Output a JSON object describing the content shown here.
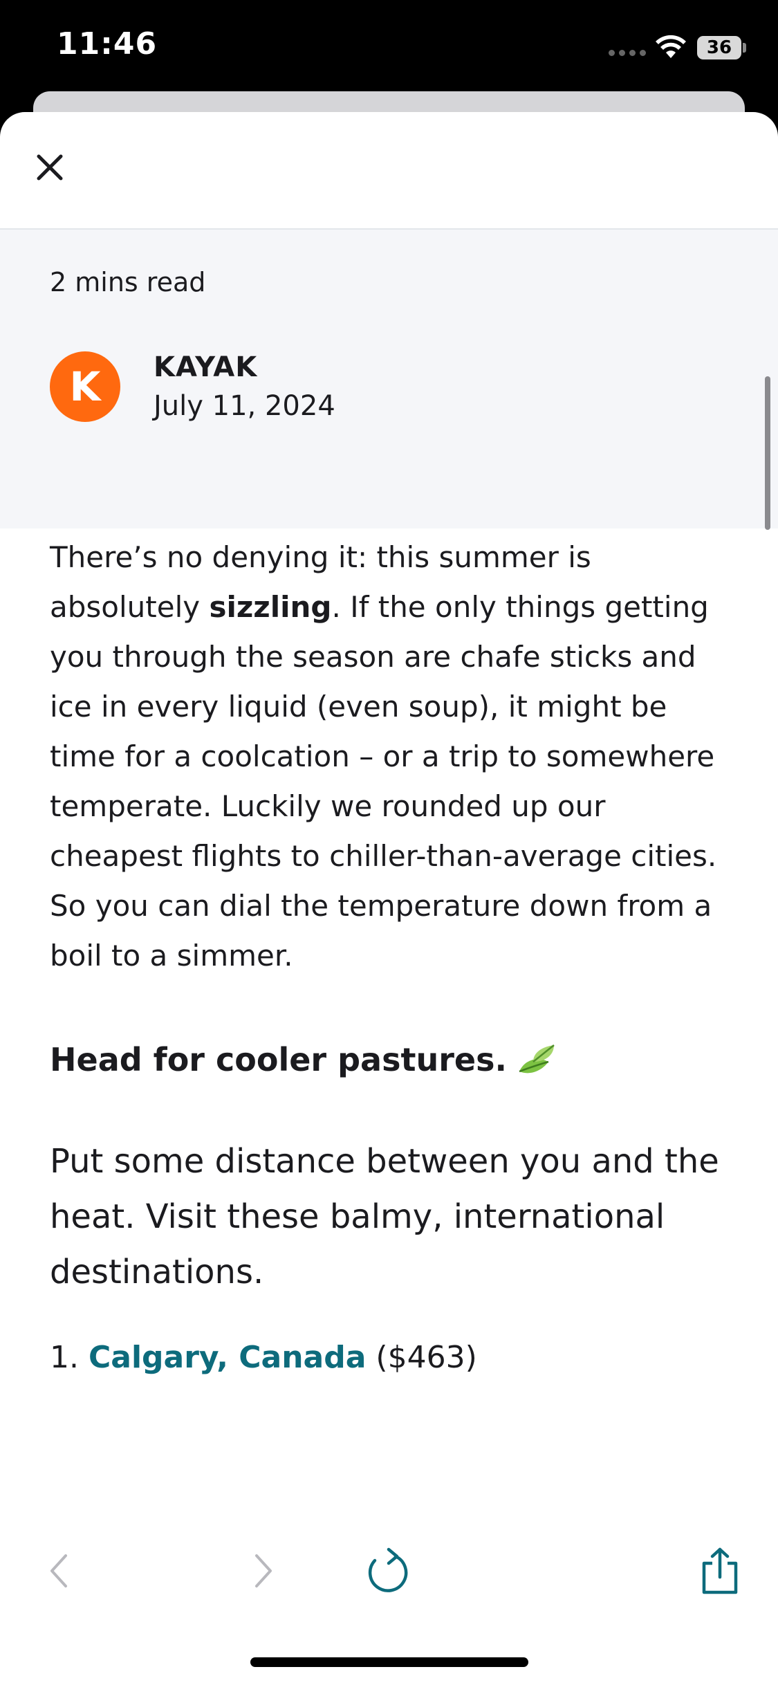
{
  "status_bar": {
    "time": "11:46",
    "battery": "36"
  },
  "article_meta": {
    "read_time": "2 mins read",
    "author_initial": "K",
    "author": "KAYAK",
    "date": "July 11, 2024"
  },
  "article": {
    "para1_a": "There’s no denying it: this summer is absolutely ",
    "para1_bold": "sizzling",
    "para1_b": ". If the only things getting you through the season are chafe sticks and ice in every liquid (even soup), it might be time for a coolcation – or a trip to somewhere temperate. Luckily we rounded up our cheapest flights to chiller-than-average cities. So you can dial the temperature down from a boil to a simmer.",
    "subhead": "Head for cooler pastures.",
    "para2": "Put some distance between you and the heat. Visit these balmy, international destinations.",
    "list": [
      {
        "number": "1.",
        "link": "Calgary, Canada",
        "price": "($463)"
      }
    ]
  },
  "toolbar": {
    "back": "back-icon",
    "forward": "forward-icon",
    "reload": "reload-icon",
    "share": "share-icon"
  },
  "colors": {
    "accent": "#0d6b7c",
    "brand": "#ff690f"
  }
}
